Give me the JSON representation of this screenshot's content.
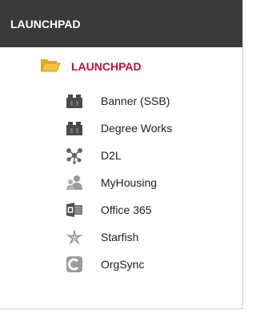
{
  "header": {
    "title": "LAUNCHPAD"
  },
  "folder": {
    "label": "LAUNCHPAD",
    "icon": "folder-open-icon",
    "color": "#c8102e"
  },
  "items": [
    {
      "label": "Banner (SSB)",
      "icon": "building-blocks-icon"
    },
    {
      "label": "Degree Works",
      "icon": "building-blocks-icon"
    },
    {
      "label": "D2L",
      "icon": "network-nodes-icon"
    },
    {
      "label": "MyHousing",
      "icon": "people-icon"
    },
    {
      "label": "Office 365",
      "icon": "office-icon"
    },
    {
      "label": "Starfish",
      "icon": "starfish-icon"
    },
    {
      "label": "OrgSync",
      "icon": "orgsync-icon"
    }
  ]
}
